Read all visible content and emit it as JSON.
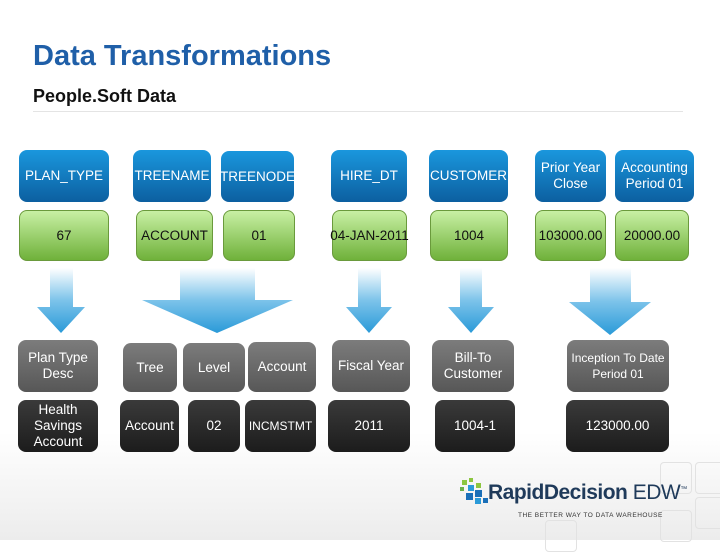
{
  "header": {
    "title": "Data Transformations",
    "subtitle": "People.Soft Data"
  },
  "source_fields": [
    "PLAN_TYPE",
    "TREENAME",
    "TREENODE",
    "HIRE_DT",
    "CUSTOMER",
    "Prior Year Close",
    "Accounting Period 01"
  ],
  "source_values": [
    "67",
    "ACCOUNT",
    "01",
    "04-JAN-2011",
    "1004",
    "103000.00",
    "20000.00"
  ],
  "target_fields": [
    "Plan Type Desc",
    "Tree",
    "Level",
    "Account",
    "Fiscal Year",
    "Bill-To Customer",
    "Inception To Date Period 01"
  ],
  "target_values": [
    "Health Savings Account",
    "Account",
    "02",
    "INCMSTMT",
    "2011",
    "1004-1",
    "123000.00"
  ],
  "logo": {
    "name": "RapidDecision",
    "suffix": "EDW",
    "tm": "™",
    "tagline": "THE BETTER WAY TO DATA WAREHOUSE"
  },
  "colors": {
    "title": "#1f5fa8",
    "source_field": "#0c5fa0",
    "source_value": "#6fb13a",
    "target_field": "#575757",
    "target_value": "#1c1c1c",
    "arrow": "#2a9ad8"
  }
}
